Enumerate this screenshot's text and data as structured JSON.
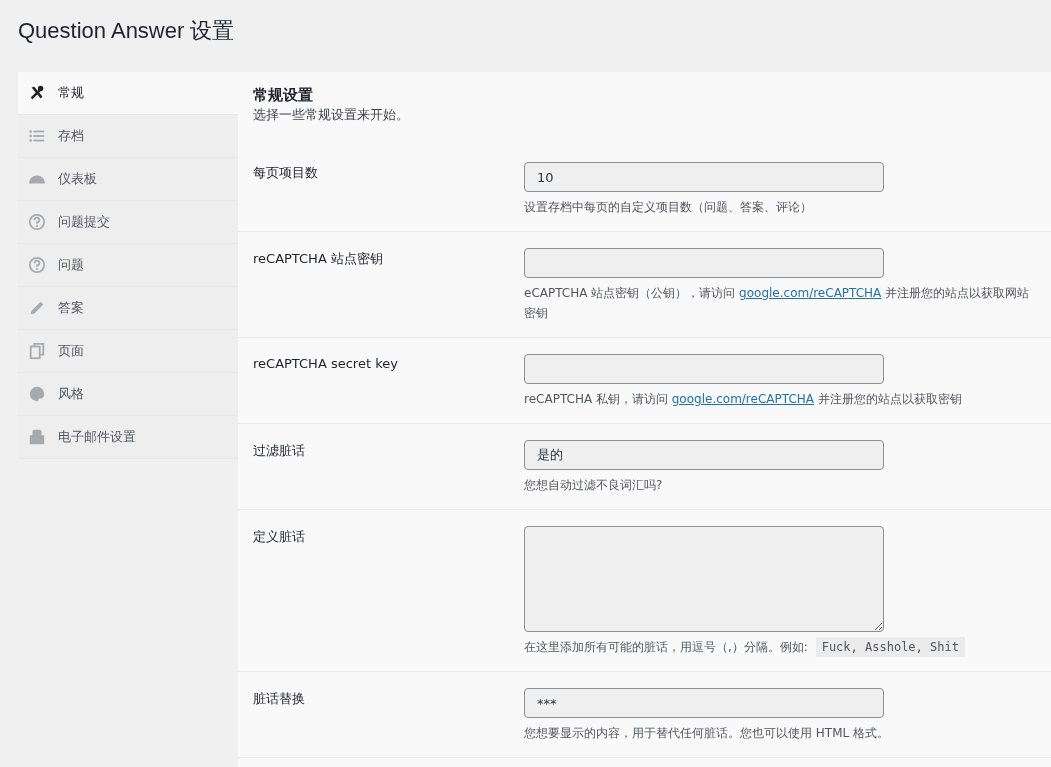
{
  "page_title": "Question Answer 设置",
  "sidebar": {
    "items": [
      {
        "label": "常规",
        "selected": true
      },
      {
        "label": "存档",
        "selected": false
      },
      {
        "label": "仪表板",
        "selected": false
      },
      {
        "label": "问题提交",
        "selected": false
      },
      {
        "label": "问题",
        "selected": false
      },
      {
        "label": "答案",
        "selected": false
      },
      {
        "label": "页面",
        "selected": false
      },
      {
        "label": "风格",
        "selected": false
      },
      {
        "label": "电子邮件设置",
        "selected": false
      }
    ]
  },
  "section": {
    "title": "常规设置",
    "subtitle": "选择一些常规设置来开始。"
  },
  "settings": [
    {
      "label": "每页项目数",
      "kind": "input",
      "value": "10",
      "description": [
        {
          "kind": "text",
          "text": "设置存档中每页的自定义项目数（问题、答案、评论）"
        }
      ]
    },
    {
      "label": "reCAPTCHA 站点密钥",
      "kind": "input",
      "description": [
        {
          "kind": "text",
          "text": "eCAPTCHA 站点密钥（公钥），请访问 "
        },
        {
          "kind": "link",
          "text": "google.com/reCAPTCHA"
        },
        {
          "kind": "text",
          "text": " 并注册您的站点以获取网站密钥"
        }
      ]
    },
    {
      "label": "reCAPTCHA secret key",
      "kind": "input",
      "description": [
        {
          "kind": "text",
          "text": "reCAPTCHA 私钥，请访问 "
        },
        {
          "kind": "link",
          "text": "google.com/reCAPTCHA"
        },
        {
          "kind": "text",
          "text": " 并注册您的站点以获取密钥"
        }
      ]
    },
    {
      "label": "过滤脏话",
      "kind": "input",
      "value": "是的",
      "description": [
        {
          "kind": "text",
          "text": "您想自动过滤不良词汇吗?"
        }
      ]
    },
    {
      "label": "定义脏话",
      "kind": "textarea",
      "description": [
        {
          "kind": "text",
          "text": "在这里添加所有可能的脏话，用逗号（,）分隔。例如: "
        },
        {
          "kind": "code",
          "text": "Fuck, Asshole, Shit"
        }
      ]
    },
    {
      "label": "脏话替换",
      "kind": "input",
      "value": "***",
      "description": [
        {
          "kind": "text",
          "text": "您想要显示的内容，用于替代任何脏话。您也可以使用 HTML 格式。"
        }
      ]
    }
  ]
}
